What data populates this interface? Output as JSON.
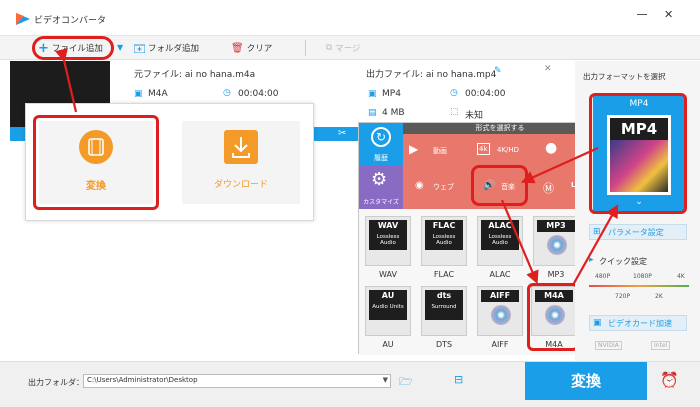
{
  "window": {
    "title": "ビデオコンバータ"
  },
  "toolbar": {
    "add_file": "ファイル追加",
    "add_folder": "フォルダ追加",
    "clear": "クリア",
    "merge": "マージ"
  },
  "file": {
    "source_label": "元ファイル: ai no hana.m4a",
    "source_format": "M4A",
    "source_duration": "00:04:00",
    "output_label": "出力ファイル: ai no hana.mp4",
    "output_format": "MP4",
    "output_duration": "00:04:00",
    "output_size": "4 MB",
    "output_res": "未知"
  },
  "popup": {
    "convert": "変換",
    "download": "ダウンロード"
  },
  "format_panel": {
    "header": "形式を選択する",
    "categories": [
      "履歴",
      "動画",
      "4K/HD",
      "カスタマイズ",
      "ウェブ",
      "音楽",
      "Le"
    ],
    "formats": [
      {
        "name": "WAV",
        "tag": "WAV",
        "sub": "Lossless Audio"
      },
      {
        "name": "FLAC",
        "tag": "FLAC",
        "sub": "Lossless Audio"
      },
      {
        "name": "ALAC",
        "tag": "ALAC",
        "sub": "Lossless Audio"
      },
      {
        "name": "MP3",
        "tag": "MP3",
        "sub": ""
      },
      {
        "name": "AU",
        "tag": "AU",
        "sub": "Audio Units"
      },
      {
        "name": "DTS",
        "tag": "dts",
        "sub": "Surround"
      },
      {
        "name": "AIFF",
        "tag": "AIFF",
        "sub": ""
      },
      {
        "name": "M4A",
        "tag": "M4A",
        "sub": ""
      }
    ]
  },
  "right_panel": {
    "title": "出力フォーマットを選択",
    "selected_format": "MP4",
    "tile_tag": "MP4",
    "param_button": "パラメータ設定",
    "quick_setting": "クイック設定",
    "res_row1": [
      "480P",
      "1080P",
      "4K"
    ],
    "res_row2": [
      "720P",
      "2K"
    ],
    "gpu_label": "ビデオカード加速",
    "gpu_brands": [
      "NVIDIA",
      "Intel"
    ]
  },
  "bottom": {
    "folder_label": "出力フォルダ：",
    "folder_path": "C:\\Users\\Administrator\\Desktop",
    "convert_button": "変換"
  },
  "colors": {
    "accent": "#1a9ee8",
    "orange": "#f39a28",
    "red": "#e01e1e",
    "salmon": "#e8786c",
    "purple": "#8a6bc4"
  }
}
